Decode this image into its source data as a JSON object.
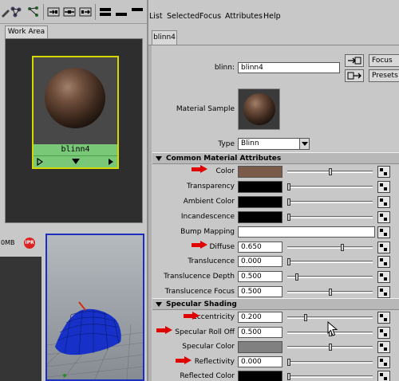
{
  "menubar": {
    "items": [
      "List",
      "Selected",
      "Focus",
      "Attributes",
      "Help"
    ]
  },
  "left": {
    "work_area_tab": "Work Area",
    "swatch_name": "blinn4",
    "strip_label": "0MB",
    "rec_label": "IPR"
  },
  "editor": {
    "tab": "blinn4",
    "node_label": "blinn:",
    "node_value": "blinn4",
    "focus_btn": "Focus",
    "presets_btn": "Presets",
    "material_sample_label": "Material Sample",
    "type_label": "Type",
    "type_value": "Blinn"
  },
  "sections": {
    "common": "Common Material Attributes",
    "specular": "Specular Shading"
  },
  "common_attrs": [
    {
      "label": "Color",
      "kind": "swatch",
      "color": "#7a5a48",
      "level": 0.5
    },
    {
      "label": "Transparency",
      "kind": "swatch",
      "color": "#000000",
      "level": 0.0
    },
    {
      "label": "Ambient Color",
      "kind": "swatch",
      "color": "#000000",
      "level": 0.0
    },
    {
      "label": "Incandescence",
      "kind": "swatch",
      "color": "#000000",
      "level": 0.0
    },
    {
      "label": "Bump Mapping",
      "kind": "field",
      "value": ""
    },
    {
      "label": "Diffuse",
      "kind": "number",
      "value": "0.650",
      "level": 0.65
    },
    {
      "label": "Translucence",
      "kind": "number",
      "value": "0.000",
      "level": 0.0
    },
    {
      "label": "Translucence Depth",
      "kind": "number",
      "value": "0.500",
      "level": 0.1
    },
    {
      "label": "Translucence Focus",
      "kind": "number",
      "value": "0.500",
      "level": 0.5
    }
  ],
  "specular_attrs": [
    {
      "label": "Eccentricity",
      "kind": "number",
      "value": "0.200",
      "level": 0.2
    },
    {
      "label": "Specular Roll Off",
      "kind": "number",
      "value": "0.500",
      "level": 0.5
    },
    {
      "label": "Specular Color",
      "kind": "swatch",
      "color": "#808080",
      "level": 0.5
    },
    {
      "label": "Reflectivity",
      "kind": "number",
      "value": "0.000",
      "level": 0.0
    },
    {
      "label": "Reflected Color",
      "kind": "swatch",
      "color": "#000000",
      "level": 0.0
    }
  ],
  "colors": {
    "highlight_arrow": "#e00000",
    "swatch_border": "#d6d600",
    "swatch_label_bg": "#78c878",
    "viewport_border": "#1a2fbf",
    "mesh": "#1630c8"
  }
}
